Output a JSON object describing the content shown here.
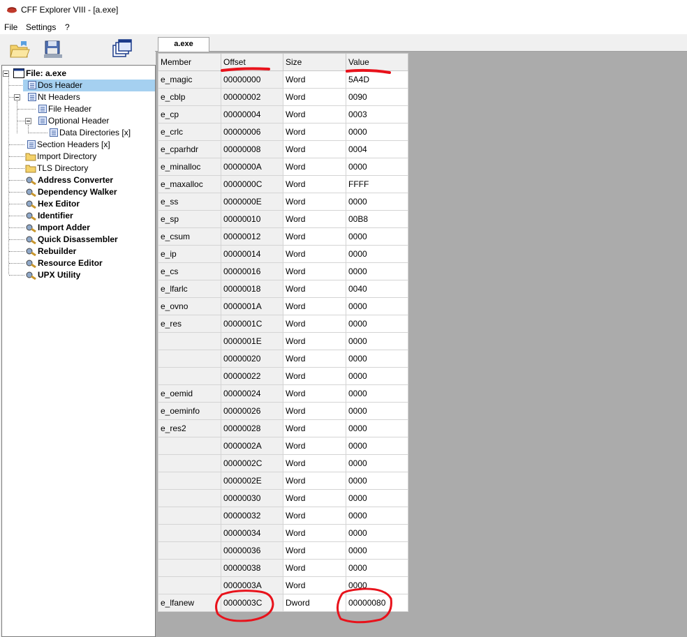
{
  "window": {
    "title": "CFF Explorer VIII - [a.exe]"
  },
  "menu": {
    "items": [
      "File",
      "Settings",
      "?"
    ]
  },
  "toolbar": {
    "buttons": [
      "open-file-icon",
      "save-file-icon",
      "windows-icon"
    ]
  },
  "tabs": [
    {
      "label": "a.exe",
      "active": true
    }
  ],
  "tree": {
    "items": [
      {
        "label": "File: a.exe",
        "bold": true,
        "icon": "window-icon",
        "selected": false
      },
      {
        "label": "Dos Header",
        "bold": false,
        "icon": "struct-icon",
        "selected": true
      },
      {
        "label": "Nt Headers",
        "bold": false,
        "icon": "struct-icon",
        "selected": false
      },
      {
        "label": "File Header",
        "bold": false,
        "icon": "struct-icon",
        "selected": false
      },
      {
        "label": "Optional Header",
        "bold": false,
        "icon": "struct-icon",
        "selected": false
      },
      {
        "label": "Data Directories [x]",
        "bold": false,
        "icon": "struct-icon",
        "selected": false
      },
      {
        "label": "Section Headers [x]",
        "bold": false,
        "icon": "struct-icon",
        "selected": false
      },
      {
        "label": "Import Directory",
        "bold": false,
        "icon": "folder-icon",
        "selected": false
      },
      {
        "label": "TLS Directory",
        "bold": false,
        "icon": "folder-icon",
        "selected": false
      },
      {
        "label": "Address Converter",
        "bold": true,
        "icon": "tool-icon",
        "selected": false
      },
      {
        "label": "Dependency Walker",
        "bold": true,
        "icon": "tool-icon",
        "selected": false
      },
      {
        "label": "Hex Editor",
        "bold": true,
        "icon": "tool-icon",
        "selected": false
      },
      {
        "label": "Identifier",
        "bold": true,
        "icon": "tool-icon",
        "selected": false
      },
      {
        "label": "Import Adder",
        "bold": true,
        "icon": "tool-icon",
        "selected": false
      },
      {
        "label": "Quick Disassembler",
        "bold": true,
        "icon": "tool-icon",
        "selected": false
      },
      {
        "label": "Rebuilder",
        "bold": true,
        "icon": "tool-icon",
        "selected": false
      },
      {
        "label": "Resource Editor",
        "bold": true,
        "icon": "tool-icon",
        "selected": false
      },
      {
        "label": "UPX Utility",
        "bold": true,
        "icon": "tool-icon",
        "selected": false
      }
    ]
  },
  "table": {
    "headers": [
      "Member",
      "Offset",
      "Size",
      "Value"
    ],
    "rows": [
      [
        "e_magic",
        "00000000",
        "Word",
        "5A4D"
      ],
      [
        "e_cblp",
        "00000002",
        "Word",
        "0090"
      ],
      [
        "e_cp",
        "00000004",
        "Word",
        "0003"
      ],
      [
        "e_crlc",
        "00000006",
        "Word",
        "0000"
      ],
      [
        "e_cparhdr",
        "00000008",
        "Word",
        "0004"
      ],
      [
        "e_minalloc",
        "0000000A",
        "Word",
        "0000"
      ],
      [
        "e_maxalloc",
        "0000000C",
        "Word",
        "FFFF"
      ],
      [
        "e_ss",
        "0000000E",
        "Word",
        "0000"
      ],
      [
        "e_sp",
        "00000010",
        "Word",
        "00B8"
      ],
      [
        "e_csum",
        "00000012",
        "Word",
        "0000"
      ],
      [
        "e_ip",
        "00000014",
        "Word",
        "0000"
      ],
      [
        "e_cs",
        "00000016",
        "Word",
        "0000"
      ],
      [
        "e_lfarlc",
        "00000018",
        "Word",
        "0040"
      ],
      [
        "e_ovno",
        "0000001A",
        "Word",
        "0000"
      ],
      [
        "e_res",
        "0000001C",
        "Word",
        "0000"
      ],
      [
        "",
        "0000001E",
        "Word",
        "0000"
      ],
      [
        "",
        "00000020",
        "Word",
        "0000"
      ],
      [
        "",
        "00000022",
        "Word",
        "0000"
      ],
      [
        "e_oemid",
        "00000024",
        "Word",
        "0000"
      ],
      [
        "e_oeminfo",
        "00000026",
        "Word",
        "0000"
      ],
      [
        "e_res2",
        "00000028",
        "Word",
        "0000"
      ],
      [
        "",
        "0000002A",
        "Word",
        "0000"
      ],
      [
        "",
        "0000002C",
        "Word",
        "0000"
      ],
      [
        "",
        "0000002E",
        "Word",
        "0000"
      ],
      [
        "",
        "00000030",
        "Word",
        "0000"
      ],
      [
        "",
        "00000032",
        "Word",
        "0000"
      ],
      [
        "",
        "00000034",
        "Word",
        "0000"
      ],
      [
        "",
        "00000036",
        "Word",
        "0000"
      ],
      [
        "",
        "00000038",
        "Word",
        "0000"
      ],
      [
        "",
        "0000003A",
        "Word",
        "0000"
      ],
      [
        "e_lfanew",
        "0000003C",
        "Dword",
        "00000080"
      ]
    ]
  },
  "colors": {
    "annotation": "#e8121b",
    "selection": "#a5d0f0",
    "workspace": "#ababab"
  }
}
